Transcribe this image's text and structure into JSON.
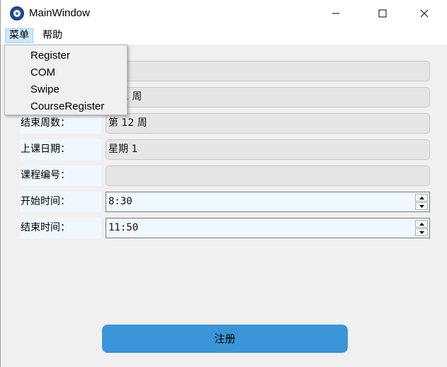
{
  "window": {
    "title": "MainWindow"
  },
  "menubar": {
    "items": [
      {
        "label": "菜单"
      },
      {
        "label": "帮助"
      }
    ]
  },
  "dropdown": {
    "items": [
      {
        "label": "Register"
      },
      {
        "label": "COM"
      },
      {
        "label": "Swipe"
      },
      {
        "label": "CourseRegister"
      }
    ]
  },
  "form": {
    "start_week_partial": "1 周",
    "end_week_label": "结束周数：",
    "end_week_value": "第 12 周",
    "class_day_label": "上课日期：",
    "class_day_value": "星期 1",
    "course_id_label": "课程编号：",
    "course_id_value": "",
    "start_time_label": "开始时间：",
    "start_time_value": "8:30",
    "end_time_label": "结束时间：",
    "end_time_value": "11:50"
  },
  "actions": {
    "register_label": "注册"
  },
  "colors": {
    "button": "#3a95d8",
    "label_bg": "#f0f8ff",
    "menu_active": "#cce8ff"
  }
}
